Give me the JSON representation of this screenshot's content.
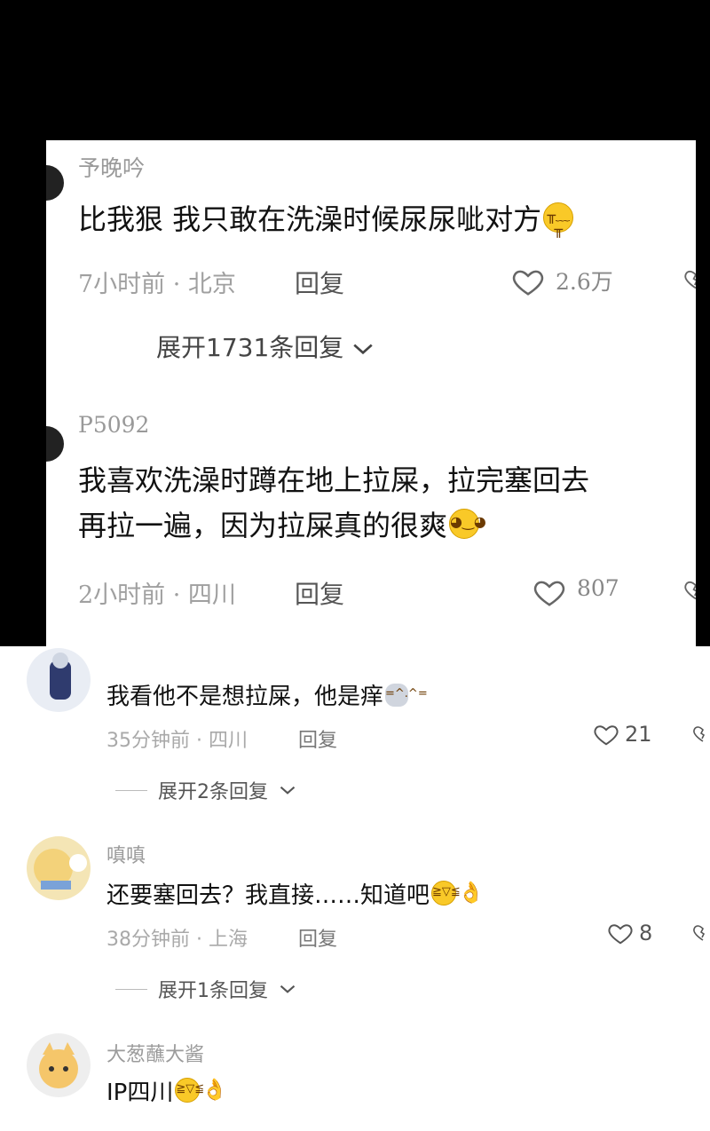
{
  "card_comments": [
    {
      "username": "予晚吟",
      "text": "比我狠 我只敢在洗澡时候尿尿呲对方",
      "emoji": "crying-face",
      "time_location": "7小时前 · 北京",
      "reply": "回复",
      "likes": "2.6万",
      "expand": "展开1731条回复"
    },
    {
      "username": "P5092",
      "text_line1": "我喜欢洗澡时蹲在地上拉屎，拉完塞回去",
      "text_line2": "再拉一遍，因为拉屎真的很爽",
      "emoji": "grinning-face",
      "time_location": "2小时前 · 四川",
      "reply": "回复",
      "likes": "807"
    }
  ],
  "comments": [
    {
      "text": "我看他不是想拉屎，他是痒",
      "emoji": "cat-face",
      "time_location": "35分钟前 · 四川",
      "reply": "回复",
      "likes": "21",
      "expand": "展开2条回复"
    },
    {
      "username": "嗔嗔",
      "text": "还要塞回去？我直接……知道吧",
      "emoji": "laughing-ok",
      "time_location": "38分钟前 · 上海",
      "reply": "回复",
      "likes": "8",
      "expand": "展开1条回复"
    },
    {
      "username": "大葱蘸大酱",
      "text": "IP四川",
      "emoji": "laughing-ok"
    }
  ],
  "colors": {
    "background": "#000000",
    "card": "#ffffff",
    "text": "#111111",
    "meta": "#a9a9a9"
  }
}
